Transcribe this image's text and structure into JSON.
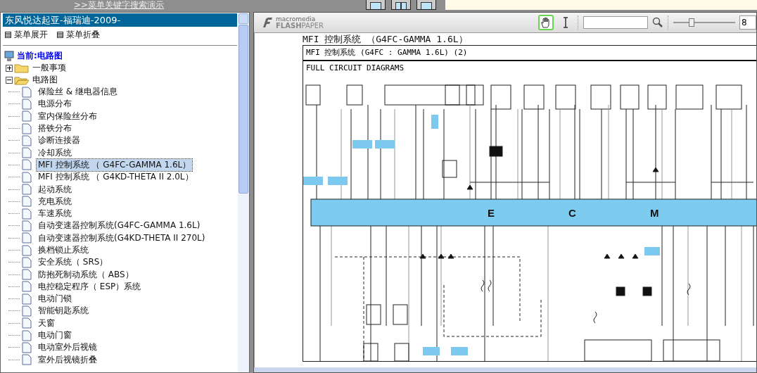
{
  "top_link": ">>菜单关键字搜索演示",
  "sidebar": {
    "header": "东风悦达起亚-福瑞迪-2009-",
    "expand_label": "菜单展开",
    "collapse_label": "菜单折叠",
    "tree": {
      "label": "当前:电路图",
      "children": [
        {
          "label": "一般事项",
          "expanded": false
        },
        {
          "label": "电路图",
          "expanded": true,
          "children": [
            {
              "label": "保险丝 & 继电器信息",
              "selected": false
            },
            {
              "label": "电源分布",
              "selected": false
            },
            {
              "label": "室内保险丝分布",
              "selected": false
            },
            {
              "label": "搭铁分布",
              "selected": false
            },
            {
              "label": "诊断连接器",
              "selected": false
            },
            {
              "label": "冷却系统",
              "selected": false
            },
            {
              "label": "MFI 控制系统 （ G4FC-GAMMA 1.6L）",
              "selected": true
            },
            {
              "label": "MFI 控制系统 （ G4KD-THETA II 2.0L）",
              "selected": false
            },
            {
              "label": "起动系统",
              "selected": false
            },
            {
              "label": "充电系统",
              "selected": false
            },
            {
              "label": "车速系统",
              "selected": false
            },
            {
              "label": "自动变速器控制系统(G4FC-GAMMA 1.6L)",
              "selected": false
            },
            {
              "label": "自动变速器控制系统(G4KD-THETA II 270L)",
              "selected": false
            },
            {
              "label": "换档锁止系统",
              "selected": false
            },
            {
              "label": "安全系统（ SRS）",
              "selected": false
            },
            {
              "label": "防抱死制动系统（ ABS）",
              "selected": false
            },
            {
              "label": "电控稳定程序（ ESP）系统",
              "selected": false
            },
            {
              "label": "电动门锁",
              "selected": false
            },
            {
              "label": "智能钥匙系统",
              "selected": false
            },
            {
              "label": "天窗",
              "selected": false
            },
            {
              "label": "电动门窗",
              "selected": false
            },
            {
              "label": "电动室外后视镜",
              "selected": false
            },
            {
              "label": "室外后视镜折叠",
              "selected": false
            }
          ]
        }
      ]
    }
  },
  "viewer": {
    "logo_top": "macromedia",
    "logo_bottom": "**FLASH**PAPER",
    "tools": [
      {
        "kind": "hand",
        "selected": true
      },
      {
        "kind": "text",
        "selected": false
      }
    ],
    "zoom": {
      "level": 0.3,
      "value": "8"
    }
  },
  "document": {
    "title": "MFI 控制系统 （G4FC-GAMMA 1.6L）",
    "header": "MFI 控制系统 (G4FC : GAMMA 1.6L) (2)",
    "subtitle": "FULL CIRCUIT DIAGRAMS",
    "ecm_letters": [
      "E",
      "C",
      "M"
    ]
  }
}
